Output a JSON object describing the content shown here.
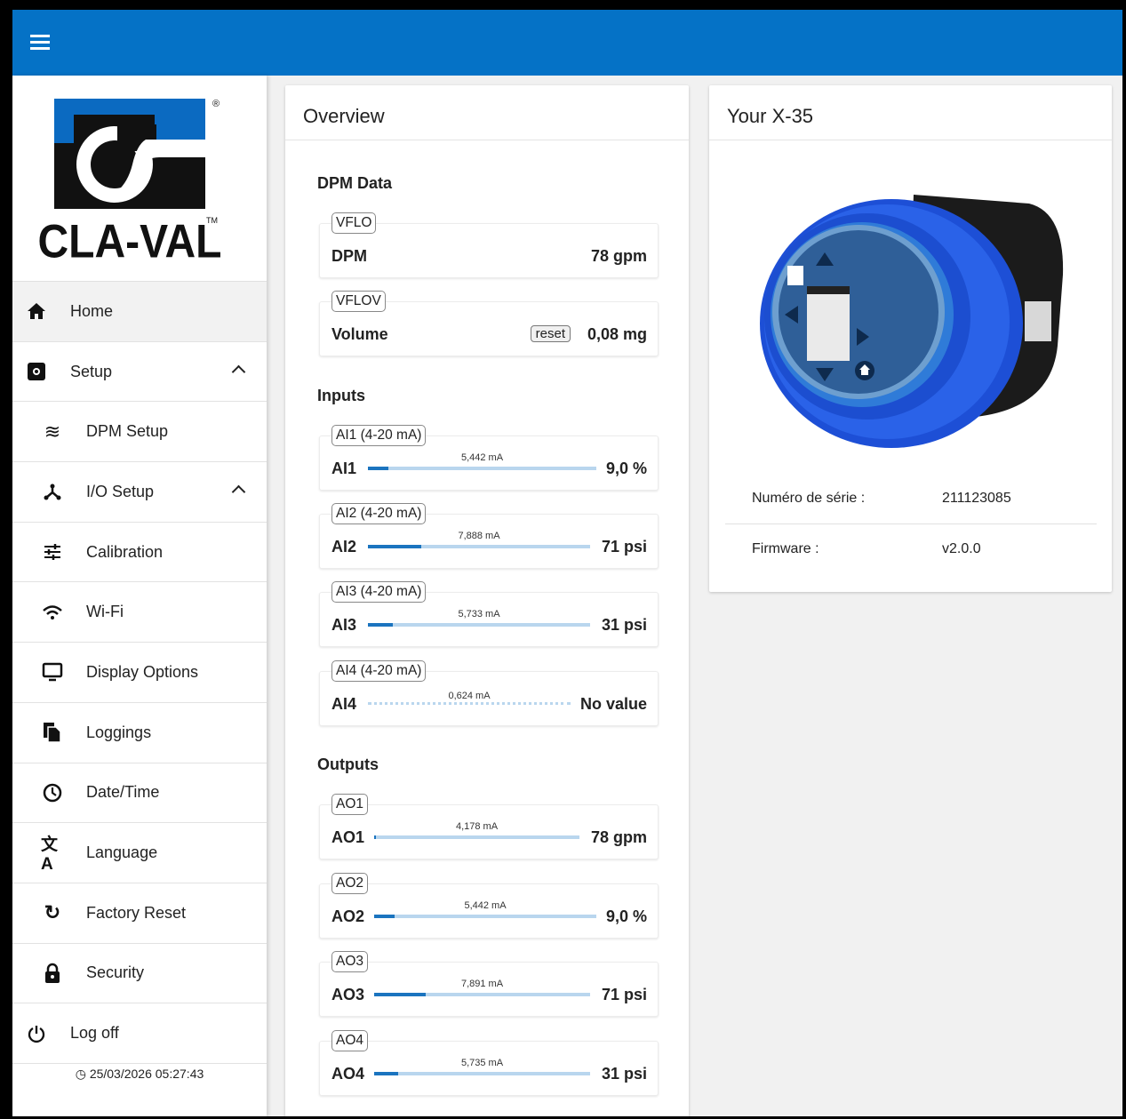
{
  "brand": {
    "name": "CLA-VAL",
    "colors": {
      "primary": "#0572c6",
      "logo_blue": "#0b6ac1"
    }
  },
  "sidebar": {
    "items": [
      {
        "label": "Home",
        "icon": "home-icon"
      },
      {
        "label": "Setup",
        "icon": "setup-icon"
      },
      {
        "label": "DPM Setup",
        "icon": "waves-icon"
      },
      {
        "label": "I/O Setup",
        "icon": "io-icon"
      },
      {
        "label": "Calibration",
        "icon": "sliders-icon"
      },
      {
        "label": "Wi-Fi",
        "icon": "wifi-icon"
      },
      {
        "label": "Display Options",
        "icon": "monitor-icon"
      },
      {
        "label": "Loggings",
        "icon": "files-icon"
      },
      {
        "label": "Date/Time",
        "icon": "clock-icon"
      },
      {
        "label": "Language",
        "icon": "translate-icon"
      },
      {
        "label": "Factory Reset",
        "icon": "refresh-icon"
      },
      {
        "label": "Security",
        "icon": "lock-icon"
      },
      {
        "label": "Log off",
        "icon": "power-icon"
      }
    ],
    "datetime": "25/03/2026 05:27:43"
  },
  "overview": {
    "title": "Overview",
    "dpm_heading": "DPM Data",
    "dpm": [
      {
        "tag": "VFLO",
        "name": "DPM",
        "value": "78 gpm"
      },
      {
        "tag": "VFLOV",
        "name": "Volume",
        "value": "0,08 mg",
        "reset": "reset"
      }
    ],
    "inputs_heading": "Inputs",
    "inputs": [
      {
        "tag": "AI1 (4-20 mA)",
        "name": "AI1",
        "ma": "5,442 mA",
        "value": "9,0 %",
        "fill": 0.09
      },
      {
        "tag": "AI2 (4-20 mA)",
        "name": "AI2",
        "ma": "7,888 mA",
        "value": "71 psi",
        "fill": 0.24
      },
      {
        "tag": "AI3 (4-20 mA)",
        "name": "AI3",
        "ma": "5,733 mA",
        "value": "31 psi",
        "fill": 0.11
      },
      {
        "tag": "AI4 (4-20 mA)",
        "name": "AI4",
        "ma": "0,624 mA",
        "value": "No value",
        "fill": 0
      }
    ],
    "outputs_heading": "Outputs",
    "outputs": [
      {
        "tag": "AO1",
        "name": "AO1",
        "ma": "4,178 mA",
        "value": "78 gpm",
        "fill": 0.01
      },
      {
        "tag": "AO2",
        "name": "AO2",
        "ma": "5,442 mA",
        "value": "9,0 %",
        "fill": 0.09
      },
      {
        "tag": "AO3",
        "name": "AO3",
        "ma": "7,891 mA",
        "value": "71 psi",
        "fill": 0.24
      },
      {
        "tag": "AO4",
        "name": "AO4",
        "ma": "5,735 mA",
        "value": "31 psi",
        "fill": 0.11
      }
    ]
  },
  "device": {
    "title": "Your X-35",
    "serial_label": "Numéro de série :",
    "serial": "211123085",
    "firmware_label": "Firmware :",
    "firmware": "v2.0.0"
  }
}
